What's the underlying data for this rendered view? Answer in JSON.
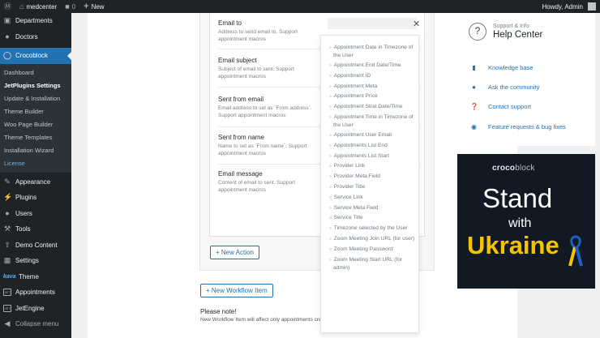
{
  "admin_bar": {
    "site_name": "medcenter",
    "comments_count": "0",
    "new_label": "New",
    "howdy": "Howdy, Admin"
  },
  "sidebar": {
    "items_top": [
      {
        "label": "Departments",
        "icon": "building-icon"
      },
      {
        "label": "Doctors",
        "icon": "users-icon"
      }
    ],
    "active": {
      "label": "Crocoblock",
      "icon": "crocoblock-icon"
    },
    "submenu": [
      {
        "label": "Dashboard"
      },
      {
        "label": "JetPlugins Settings"
      },
      {
        "label": "Update & Installation"
      },
      {
        "label": "Theme Builder"
      },
      {
        "label": "Woo Page Builder"
      },
      {
        "label": "Theme Templates"
      },
      {
        "label": "Installation Wizard"
      },
      {
        "label": "License"
      }
    ],
    "items_bottom": [
      {
        "label": "Appearance",
        "icon": "brush-icon"
      },
      {
        "label": "Plugins",
        "icon": "plug-icon"
      },
      {
        "label": "Users",
        "icon": "user-icon"
      },
      {
        "label": "Tools",
        "icon": "wrench-icon"
      },
      {
        "label": "Demo Content",
        "icon": "upload-icon"
      },
      {
        "label": "Settings",
        "icon": "settings-icon"
      },
      {
        "label": "Theme",
        "icon": "kava-logo"
      },
      {
        "label": "Appointments",
        "icon": "jet-icon",
        "icon_text": "JET"
      },
      {
        "label": "JetEngine",
        "icon": "jet-icon",
        "icon_text": "JET"
      },
      {
        "label": "Collapse menu",
        "icon": "collapse-icon"
      }
    ]
  },
  "action_fields": [
    {
      "label": "Email to",
      "desc": "Address to send email to. Support appointment macros"
    },
    {
      "label": "Email subject",
      "desc": "Subject of email to sent. Support appointment macros"
    },
    {
      "label": "Sent from email",
      "desc": "Email address to set as `From address`. Support appointment macros"
    },
    {
      "label": "Sent from name",
      "desc": "Name to set as `From name`. Support appointment macros"
    },
    {
      "label": "Email message",
      "desc": "Content of email to sent. Support appointment macros"
    }
  ],
  "macros_dropdown": [
    "Appointment Date in Timezone of the User",
    "Appointment End Date/Time",
    "Appointment ID",
    "Appointment Meta",
    "Appointment Price",
    "Appointment Strat Date/Time",
    "Appointment Time in Timezone of the User",
    "Appointment User Email",
    "Appointments List End",
    "Appointments List Start",
    "Provider Link",
    "Provider Meta Field",
    "Provider Title",
    "Service Link",
    "Service Meta Field",
    "Service Title",
    "Timezone selected by the User",
    "Zoom Meeting Join URL (for user)",
    "Zoom Meeting Password",
    "Zoom Meeting Start URL (for admin)"
  ],
  "buttons": {
    "new_action": "+ New Action",
    "new_workflow_item": "+ New Workflow Item"
  },
  "note": {
    "title": "Please note!",
    "text": "New Workflow Item will affect only appointments created after"
  },
  "help_center": {
    "subtitle": "Support & Info",
    "title": "Help Center",
    "links": [
      {
        "label": "Knowledge base",
        "icon": "book-icon"
      },
      {
        "label": "Ask the community",
        "icon": "facebook-icon"
      },
      {
        "label": "Contact support",
        "icon": "question-icon"
      },
      {
        "label": "Feature requests & bug fixes",
        "icon": "github-icon"
      }
    ]
  },
  "banner": {
    "brand_a": "croco",
    "brand_b": "block",
    "line1": "Stand",
    "line2": "with",
    "line3": "Ukraine",
    "colors": {
      "bg": "#111a24",
      "yellow": "#f5c400",
      "blue": "#1f5fbf"
    }
  },
  "colors": {
    "accent": "#2271b1",
    "sidebar_bg": "#1d2327"
  }
}
